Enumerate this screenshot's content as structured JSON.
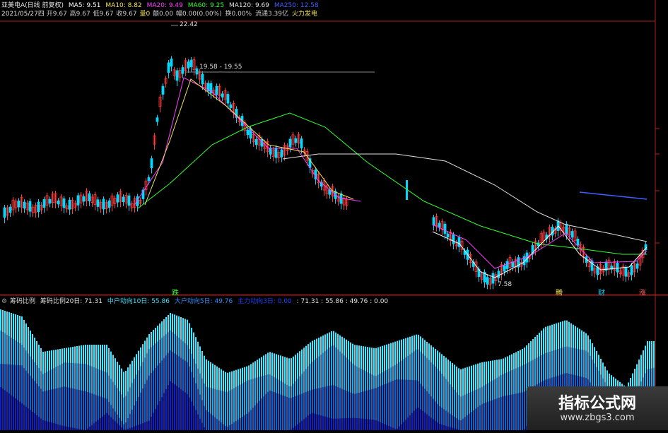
{
  "header1": {
    "stock_title": "亚美电A(日线 前复权)",
    "ma5": "MA5: 9.51",
    "ma10": "MA10: 8.82",
    "ma20": "MA20: 9.49",
    "ma60": "MA60: 9.25",
    "ma120": "MA120: 9.69",
    "ma250": "MA250: 12.58"
  },
  "header2": {
    "date": "2021/05/27四",
    "open": "开9.67",
    "high": "高9.67",
    "low": "低9.67",
    "close": "收9.67",
    "volume": "量0",
    "amount": "额0.00",
    "change": "幅0.00(0.00%)",
    "turnover": "换0.00%",
    "float": "流通3.39亿",
    "sector": "火力发电"
  },
  "annotations": {
    "high_label": "22.42",
    "range_label": "19.58 - 19.55",
    "low_label": "7.58"
  },
  "markers": [
    "跌",
    "腾",
    "财",
    "涨"
  ],
  "indicator": {
    "title": "筹码比例",
    "line1": "筹码比例20日: 71.31",
    "line2": "中户动向10日: 55.86",
    "line3": "大户动向5日: 49.76",
    "line4": "主力动向3日: 0.00",
    "values": ": 71.31 : 55.86 : 49.76 : 0.00"
  },
  "watermark": {
    "name": "指标公式网",
    "url": "www.zbgs3.com"
  },
  "colors": {
    "up": "#ff3b3b",
    "down": "#00d8ff",
    "ma5": "#ffffff",
    "ma10": "#f0e050",
    "ma20": "#ff40ff",
    "ma60": "#30ff30",
    "ma120": "#e0e0e0",
    "ma250": "#4060ff",
    "panel_border": "#b02020"
  }
}
